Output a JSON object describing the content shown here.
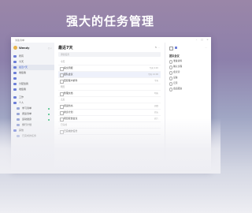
{
  "headline": "强大的任务管理",
  "app": {
    "window_title": "滴答清单",
    "brand": "Wendy",
    "sidebar_tools": "○ ⌕",
    "window_controls": [
      "–",
      "□",
      "×"
    ]
  },
  "sidebar": {
    "items": [
      {
        "label": "所有",
        "active": false
      },
      {
        "label": "今天",
        "active": false
      },
      {
        "label": "最近7天",
        "active": true
      },
      {
        "label": "收集箱",
        "active": false
      },
      {
        "label": "",
        "active": false
      },
      {
        "label": "分配给我",
        "active": false
      },
      {
        "label": "收集箱",
        "active": false
      }
    ],
    "lists": [
      {
        "label": "工作",
        "sub": false,
        "dot": false
      },
      {
        "label": "个人",
        "sub": false,
        "dot": false
      },
      {
        "label": "学习清单",
        "sub": true,
        "dot": true
      },
      {
        "label": "阅读清单",
        "sub": true,
        "dot": true
      },
      {
        "label": "运动健身",
        "sub": true,
        "dot": true
      },
      {
        "label": "旅行计划",
        "sub": true,
        "dot": false
      },
      {
        "label": "其他",
        "sub": false,
        "dot": false
      },
      {
        "label": "已完成的任务",
        "sub": true,
        "dot": false
      }
    ]
  },
  "main": {
    "title": "最近7天",
    "tools": "⇅  ···",
    "add_placeholder": "添加任务",
    "tasks": [
      {
        "kind": "group",
        "text": "今天",
        "date": ""
      },
      {
        "kind": "task",
        "text": "提交周报",
        "date": "今天 9:00",
        "selected": false
      },
      {
        "kind": "task",
        "text": "团队会议",
        "date": "今天 14:00",
        "selected": true
      },
      {
        "kind": "task",
        "text": "回复客户邮件",
        "date": "今天",
        "selected": false
      },
      {
        "kind": "group",
        "text": "明天",
        "date": ""
      },
      {
        "kind": "task",
        "text": "整理文档",
        "date": "明天",
        "selected": false
      },
      {
        "kind": "group",
        "text": "之后",
        "date": ""
      },
      {
        "kind": "task",
        "text": "阅读新书",
        "date": "周四",
        "selected": false
      },
      {
        "kind": "task",
        "text": "健身计划",
        "date": "周五",
        "selected": false
      },
      {
        "kind": "task",
        "text": "项目复盘会议",
        "date": "周六",
        "selected": false
      },
      {
        "kind": "group",
        "text": "已完成",
        "date": ""
      },
      {
        "kind": "task",
        "text": "已完成的任务",
        "date": "",
        "selected": false
      }
    ]
  },
  "detail": {
    "title": "团队会议",
    "more": "···",
    "subtasks": [
      "准备资料",
      "确认议程",
      "会议室",
      "设备",
      "记录",
      "会后跟进"
    ]
  },
  "colors": {
    "accent": "#3b5ccc",
    "active_bg": "#e4e7ef",
    "list_dot": "#3fbf7f",
    "avatar": "#e6b34a"
  }
}
